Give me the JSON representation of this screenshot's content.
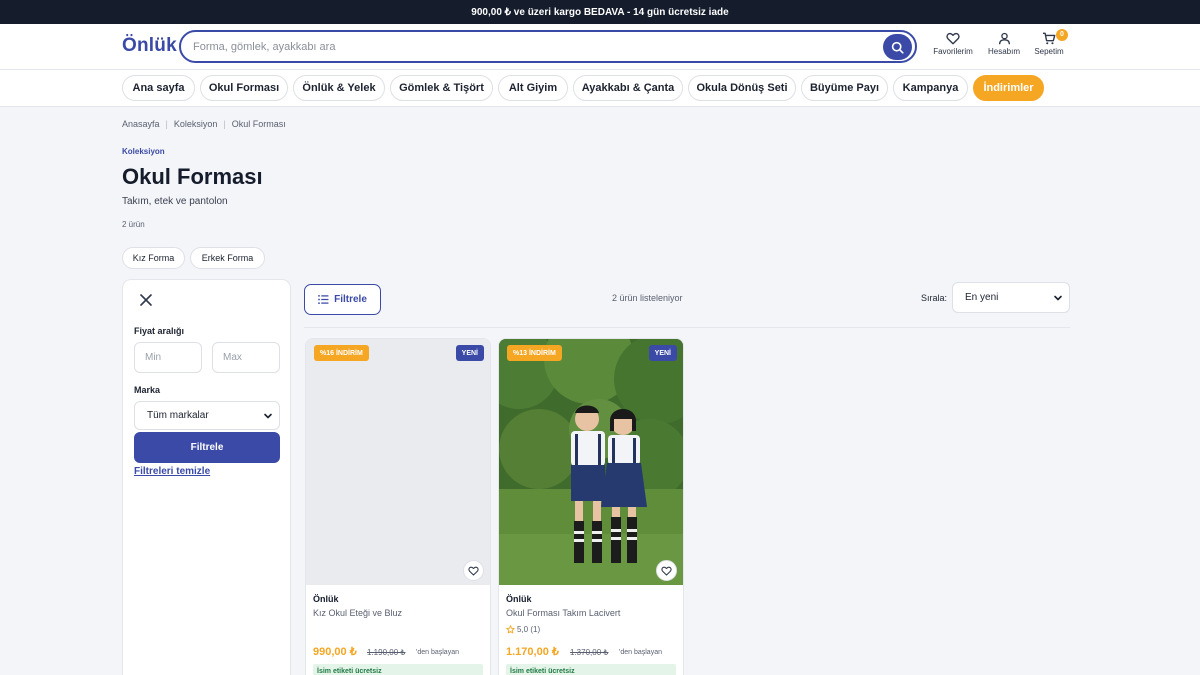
{
  "promo_bar": {
    "text": "900,00 ₺ ve üzeri kargo BEDAVA - 14 gün ücretsiz iade"
  },
  "header": {
    "logo": "Önlük",
    "search_placeholder": "Forma, gömlek, ayakkabı ara",
    "actions": [
      {
        "label": "Favorilerim",
        "icon": "heart-icon"
      },
      {
        "label": "Hesabım",
        "icon": "user-icon"
      },
      {
        "label": "Sepetim",
        "icon": "cart-icon",
        "badge": "0"
      }
    ]
  },
  "nav": {
    "items": [
      "Ana sayfa",
      "Okul Forması",
      "Önlük & Yelek",
      "Gömlek & Tişört",
      "Alt Giyim",
      "Ayakkabı & Çanta",
      "Okula Dönüş Seti",
      "Büyüme Payı",
      "Kampanya",
      "İndirimler"
    ]
  },
  "breadcrumb": [
    "Anasayfa",
    "Koleksiyon",
    "Okul Forması"
  ],
  "collection": {
    "eyebrow": "Koleksiyon",
    "title": "Okul Forması",
    "subtitle": "Takım, etek ve pantolon",
    "count": "2 ürün",
    "chips": [
      "Kız Forma",
      "Erkek Forma"
    ]
  },
  "filters": {
    "price_label": "Fiyat aralığı",
    "min_placeholder": "Min",
    "max_placeholder": "Max",
    "brand_label": "Marka",
    "brand_value": "Tüm markalar",
    "apply_label": "Filtrele",
    "clear_label": "Filtreleri temizle"
  },
  "toolbar": {
    "filter_button": "Filtrele",
    "listing_text": "2 ürün listeleniyor",
    "sort_label": "Sırala:",
    "sort_value": "En yeni"
  },
  "products": [
    {
      "discount": "%16 İNDİRİM",
      "badge": "YENİ",
      "brand": "Önlük",
      "name": "Kız Okul Eteği ve Bluz",
      "price": "990,00 ₺",
      "old_price": "1.190,00 ₺",
      "from_text": "'den başlayan",
      "tag": "İsim etiketi ücretsiz",
      "has_image": false
    },
    {
      "discount": "%13 İNDİRİM",
      "badge": "YENİ",
      "brand": "Önlük",
      "name": "Okul Forması Takım Lacivert",
      "rating": "5,0 (1)",
      "price": "1.170,00 ₺",
      "old_price": "1.370,00 ₺",
      "from_text": "'den başlayan",
      "tag": "İsim etiketi ücretsiz",
      "has_image": true
    }
  ],
  "colors": {
    "primary": "#3a4aa6",
    "accent": "#f5a623",
    "dark": "#151c2c",
    "success_bg": "#e4f4e9"
  }
}
